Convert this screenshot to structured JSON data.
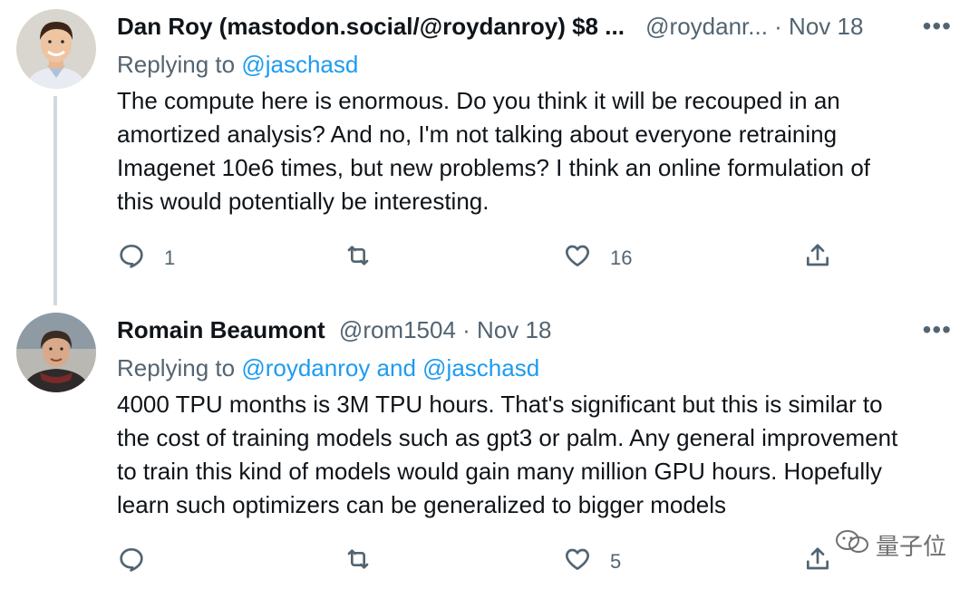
{
  "tweets": [
    {
      "author_name": "Dan Roy (mastodon.social/@roydanroy) $8 ...",
      "handle_date": "@roydanr... · Nov 18",
      "more": "•••",
      "replying_prefix": "Replying to ",
      "replying_handles": "@jaschasd",
      "text_lines": [
        "The compute here is enormous. Do you think it will be recouped in an",
        "amortized analysis? And no, I'm not talking about everyone retraining",
        "Imagenet 10e6 times, but new problems? I think an online formulation of",
        "this would potentially be interesting."
      ],
      "reply_count": "1",
      "retweet_count": "",
      "like_count": "16"
    },
    {
      "author_name": "Romain Beaumont",
      "handle_date": "@rom1504 · Nov 18",
      "more": "•••",
      "replying_prefix": "Replying to ",
      "replying_handles": "@roydanroy and @jaschasd",
      "text_lines": [
        "4000 TPU months is 3M TPU hours. That's significant but this is similar to",
        "the cost of training models such as gpt3 or palm. Any general improvement",
        "to train this kind of models would gain many million GPU hours. Hopefully",
        "learn such optimizers can be generalized to bigger models"
      ],
      "reply_count": "",
      "retweet_count": "",
      "like_count": "5"
    }
  ],
  "watermark": "量子位",
  "icons": {
    "reply": "reply-icon",
    "retweet": "retweet-icon",
    "like": "heart-icon",
    "share": "share-icon",
    "more": "more-icon"
  },
  "colors": {
    "text": "#0f1419",
    "muted": "#536471",
    "link": "#1d9bf0",
    "thread_line": "#cfd9de"
  }
}
